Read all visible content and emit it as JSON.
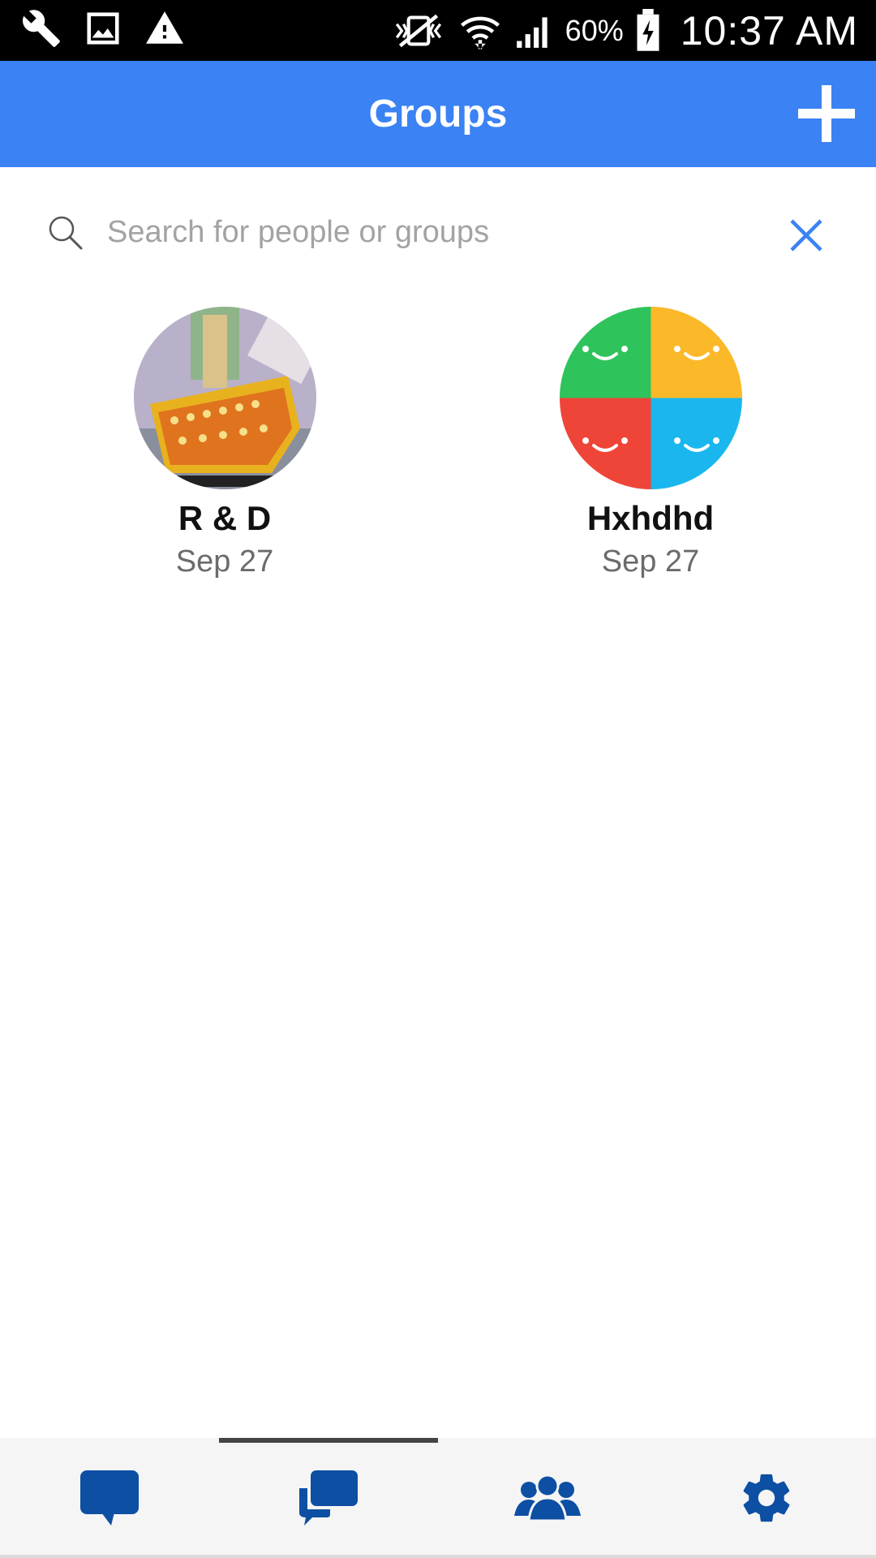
{
  "status_bar": {
    "battery_percent": "60%",
    "time": "10:37 AM",
    "icons": [
      "wrench-icon",
      "image-icon",
      "warning-icon",
      "vibrate-icon",
      "wifi-icon",
      "signal-icon",
      "battery-icon"
    ]
  },
  "app_bar": {
    "title": "Groups",
    "add_icon": "plus-icon"
  },
  "search": {
    "placeholder": "Search for people or groups",
    "value": "",
    "icon": "search-icon",
    "clear_icon": "close-icon"
  },
  "groups": [
    {
      "name": "R & D",
      "date": "Sep 27",
      "avatar": "photo-avatar"
    },
    {
      "name": "Hxhdhd",
      "date": "Sep 27",
      "avatar": "quadrant-smiley-avatar"
    }
  ],
  "bottom_nav": {
    "selected_index": 1,
    "items": [
      {
        "icon": "chat-bubble-icon"
      },
      {
        "icon": "group-chat-icon"
      },
      {
        "icon": "contacts-icon"
      },
      {
        "icon": "settings-gear-icon"
      }
    ]
  },
  "colors": {
    "app_bar": "#3b82f4",
    "nav_icon": "#0d4fa3",
    "quadrant_green": "#2fc35b",
    "quadrant_yellow": "#fbb829",
    "quadrant_red": "#ef4438",
    "quadrant_blue": "#1ab7ee"
  }
}
